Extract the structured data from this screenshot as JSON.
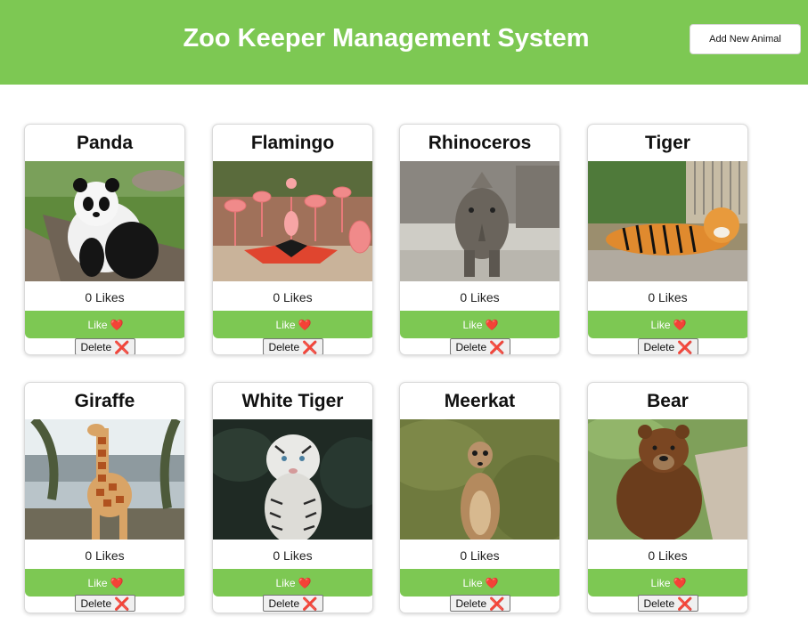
{
  "header": {
    "title": "Zoo Keeper Management System",
    "add_button_label": "Add New Animal",
    "accent_color": "#7dc853"
  },
  "animals": [
    {
      "name": "Panda",
      "likes_text": "0 Likes",
      "like_label": "Like",
      "heart_icon": "❤️",
      "delete_label": "Delete",
      "delete_icon": "❌"
    },
    {
      "name": "Flamingo",
      "likes_text": "0 Likes",
      "like_label": "Like",
      "heart_icon": "❤️",
      "delete_label": "Delete",
      "delete_icon": "❌"
    },
    {
      "name": "Rhinoceros",
      "likes_text": "0 Likes",
      "like_label": "Like",
      "heart_icon": "❤️",
      "delete_label": "Delete",
      "delete_icon": "❌"
    },
    {
      "name": "Tiger",
      "likes_text": "0 Likes",
      "like_label": "Like",
      "heart_icon": "❤️",
      "delete_label": "Delete",
      "delete_icon": "❌"
    },
    {
      "name": "Giraffe",
      "likes_text": "0 Likes",
      "like_label": "Like",
      "heart_icon": "❤️",
      "delete_label": "Delete",
      "delete_icon": "❌"
    },
    {
      "name": "White Tiger",
      "likes_text": "0 Likes",
      "like_label": "Like",
      "heart_icon": "❤️",
      "delete_label": "Delete",
      "delete_icon": "❌"
    },
    {
      "name": "Meerkat",
      "likes_text": "0 Likes",
      "like_label": "Like",
      "heart_icon": "❤️",
      "delete_label": "Delete",
      "delete_icon": "❌"
    },
    {
      "name": "Bear",
      "likes_text": "0 Likes",
      "like_label": "Like",
      "heart_icon": "❤️",
      "delete_label": "Delete",
      "delete_icon": "❌"
    }
  ]
}
